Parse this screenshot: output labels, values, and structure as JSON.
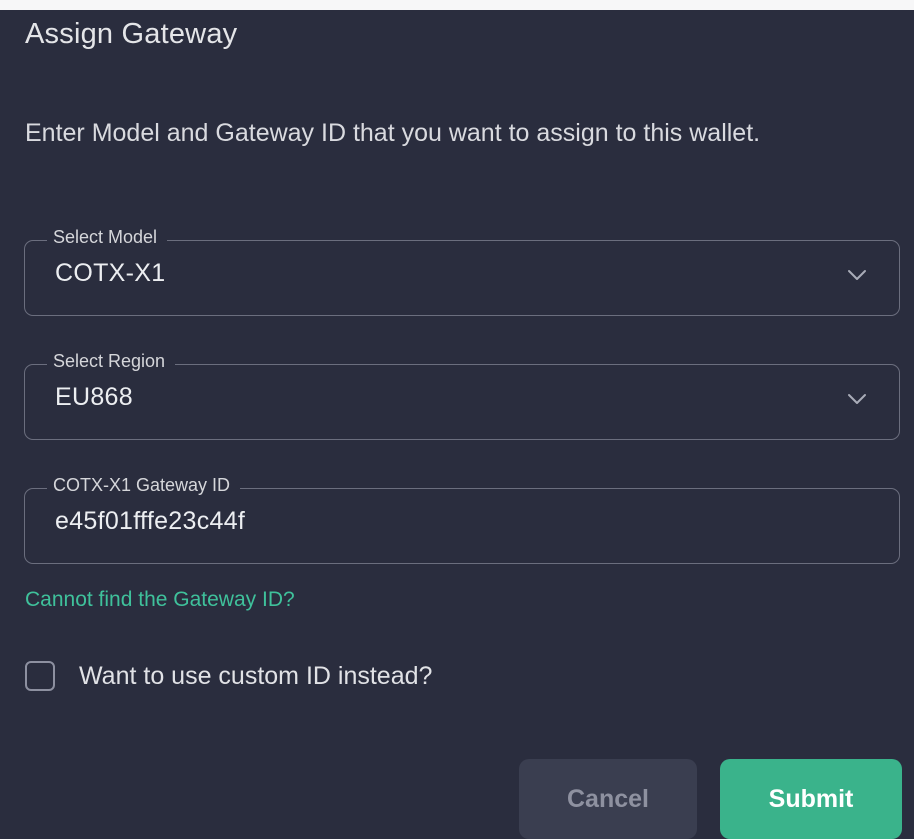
{
  "dialog": {
    "title": "Assign Gateway",
    "description": "Enter Model and Gateway ID that you want to assign to this wallet."
  },
  "fields": {
    "model": {
      "label": "Select Model",
      "value": "COTX-X1",
      "icon": "chevron-down-icon"
    },
    "region": {
      "label": "Select Region",
      "value": "EU868",
      "icon": "chevron-down-icon"
    },
    "gateway_id": {
      "label": "COTX-X1 Gateway ID",
      "value": "e45f01fffe23c44f"
    }
  },
  "help_link": "Cannot find the Gateway ID?",
  "custom_id": {
    "label": "Want to use custom ID instead?",
    "checked": false
  },
  "buttons": {
    "cancel": "Cancel",
    "submit": "Submit"
  },
  "colors": {
    "dialog_background": "#2a2d3e",
    "accent": "#3ab38b",
    "link": "#3fc19b",
    "field_border": "#6b6e7e"
  }
}
